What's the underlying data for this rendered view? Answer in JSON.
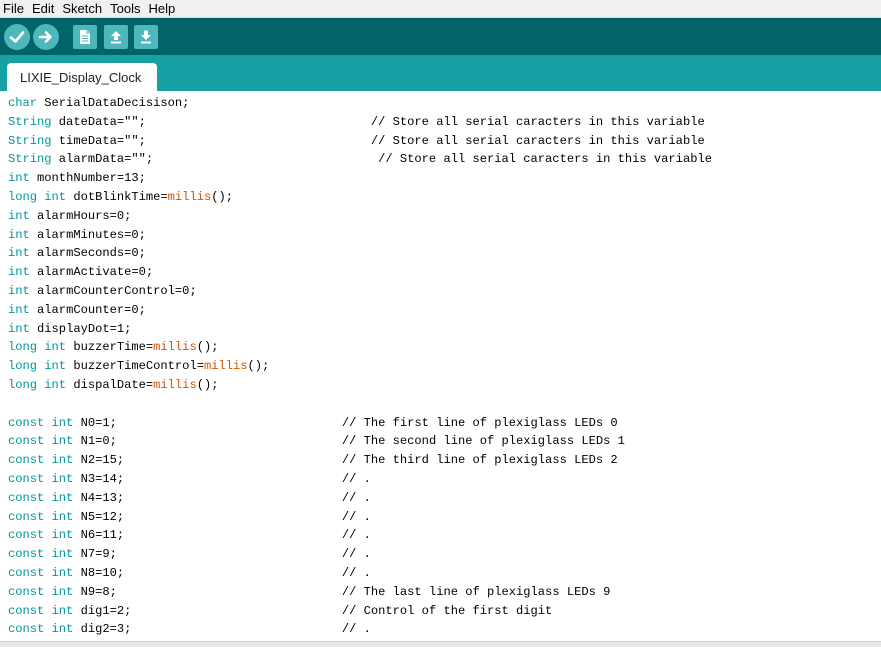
{
  "menu": [
    "File",
    "Edit",
    "Sketch",
    "Tools",
    "Help"
  ],
  "toolbar": {
    "buttons": [
      "verify-icon",
      "upload-icon",
      "new-icon",
      "open-icon",
      "save-icon"
    ]
  },
  "tab": {
    "label": "LIXIE_Display_Clock"
  },
  "colors": {
    "toolbar": "#006468",
    "tabbar": "#17a1a5",
    "button": "#4db7bb",
    "keyword": "#00979c",
    "function": "#d35400"
  },
  "code": [
    [
      {
        "t": "char",
        "c": "kw"
      },
      {
        "t": " SerialDataDecisison;"
      }
    ],
    [
      {
        "t": "String",
        "c": "kw"
      },
      {
        "t": " dateData=\"\";                               // Store all serial caracters in this variable"
      }
    ],
    [
      {
        "t": "String",
        "c": "kw"
      },
      {
        "t": " timeData=\"\";                               // Store all serial caracters in this variable"
      }
    ],
    [
      {
        "t": "String",
        "c": "kw"
      },
      {
        "t": " alarmData=\"\";                               // Store all serial caracters in this variable"
      }
    ],
    [
      {
        "t": "int",
        "c": "kw"
      },
      {
        "t": " monthNumber=13;"
      }
    ],
    [
      {
        "t": "long int",
        "c": "kw"
      },
      {
        "t": " dotBlinkTime="
      },
      {
        "t": "millis",
        "c": "fn"
      },
      {
        "t": "();"
      }
    ],
    [
      {
        "t": "int",
        "c": "kw"
      },
      {
        "t": " alarmHours=0;"
      }
    ],
    [
      {
        "t": "int",
        "c": "kw"
      },
      {
        "t": " alarmMinutes=0;"
      }
    ],
    [
      {
        "t": "int",
        "c": "kw"
      },
      {
        "t": " alarmSeconds=0;"
      }
    ],
    [
      {
        "t": "int",
        "c": "kw"
      },
      {
        "t": " alarmActivate=0;"
      }
    ],
    [
      {
        "t": "int",
        "c": "kw"
      },
      {
        "t": " alarmCounterControl=0;"
      }
    ],
    [
      {
        "t": "int",
        "c": "kw"
      },
      {
        "t": " alarmCounter=0;"
      }
    ],
    [
      {
        "t": "int",
        "c": "kw"
      },
      {
        "t": " displayDot=1;"
      }
    ],
    [
      {
        "t": "long int",
        "c": "kw"
      },
      {
        "t": " buzzerTime="
      },
      {
        "t": "millis",
        "c": "fn"
      },
      {
        "t": "();"
      }
    ],
    [
      {
        "t": "long int",
        "c": "kw"
      },
      {
        "t": " buzzerTimeControl="
      },
      {
        "t": "millis",
        "c": "fn"
      },
      {
        "t": "();"
      }
    ],
    [
      {
        "t": "long int",
        "c": "kw"
      },
      {
        "t": " dispalDate="
      },
      {
        "t": "millis",
        "c": "fn"
      },
      {
        "t": "();"
      }
    ],
    [],
    [
      {
        "t": "const int",
        "c": "kw"
      },
      {
        "t": " N0=1;                               // The first line of plexiglass LEDs 0"
      }
    ],
    [
      {
        "t": "const int",
        "c": "kw"
      },
      {
        "t": " N1=0;                               // The second line of plexiglass LEDs 1"
      }
    ],
    [
      {
        "t": "const int",
        "c": "kw"
      },
      {
        "t": " N2=15;                              // The third line of plexiglass LEDs 2"
      }
    ],
    [
      {
        "t": "const int",
        "c": "kw"
      },
      {
        "t": " N3=14;                              // ."
      }
    ],
    [
      {
        "t": "const int",
        "c": "kw"
      },
      {
        "t": " N4=13;                              // ."
      }
    ],
    [
      {
        "t": "const int",
        "c": "kw"
      },
      {
        "t": " N5=12;                              // ."
      }
    ],
    [
      {
        "t": "const int",
        "c": "kw"
      },
      {
        "t": " N6=11;                              // ."
      }
    ],
    [
      {
        "t": "const int",
        "c": "kw"
      },
      {
        "t": " N7=9;                               // ."
      }
    ],
    [
      {
        "t": "const int",
        "c": "kw"
      },
      {
        "t": " N8=10;                              // ."
      }
    ],
    [
      {
        "t": "const int",
        "c": "kw"
      },
      {
        "t": " N9=8;                               // The last line of plexiglass LEDs 9"
      }
    ],
    [
      {
        "t": "const int",
        "c": "kw"
      },
      {
        "t": " dig1=2;                             // Control of the first digit"
      }
    ],
    [
      {
        "t": "const int",
        "c": "kw"
      },
      {
        "t": " dig2=3;                             // ."
      }
    ]
  ]
}
